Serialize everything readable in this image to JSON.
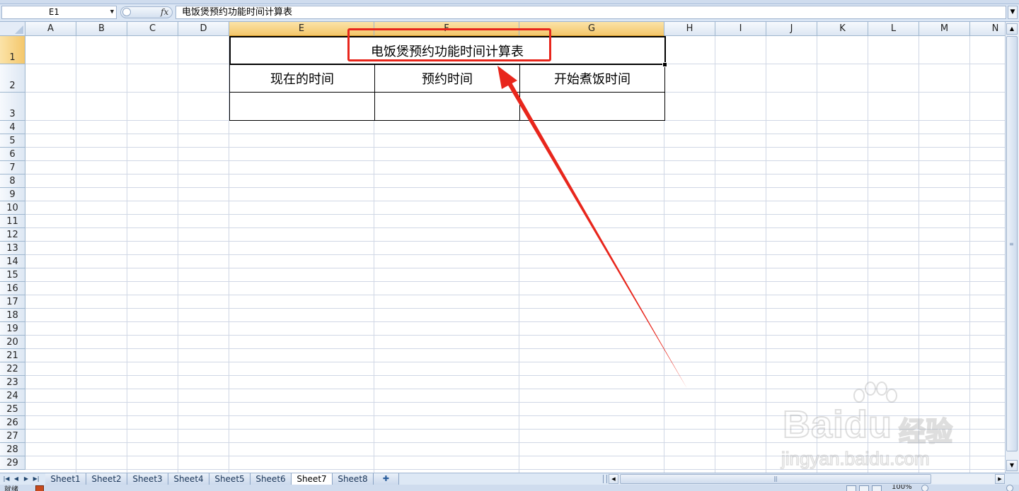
{
  "formula_bar": {
    "name_box": "E1",
    "fx_label": "fx",
    "content": "电饭煲预约功能时间计算表"
  },
  "columns": [
    "A",
    "B",
    "C",
    "D",
    "E",
    "F",
    "G",
    "H",
    "I",
    "J",
    "K",
    "L",
    "M",
    "N"
  ],
  "rows": [
    "1",
    "2",
    "3",
    "4",
    "5",
    "6",
    "7",
    "8",
    "9",
    "10",
    "11",
    "12",
    "13",
    "14",
    "15",
    "16",
    "17",
    "18",
    "19",
    "20",
    "21",
    "22",
    "23",
    "24",
    "25",
    "26",
    "27",
    "28",
    "29"
  ],
  "selected_cell": "E1",
  "table": {
    "title": "电饭煲预约功能时间计算表",
    "headers": [
      "现在的时间",
      "预约时间",
      "开始煮饭时间"
    ],
    "values": [
      "",
      "",
      ""
    ]
  },
  "sheet_tabs": [
    "Sheet1",
    "Sheet2",
    "Sheet3",
    "Sheet4",
    "Sheet5",
    "Sheet6",
    "Sheet7",
    "Sheet8"
  ],
  "active_sheet": "Sheet7",
  "status_bar": {
    "status": "就绪",
    "zoom": "100%"
  },
  "watermark": {
    "brand": "Baidu",
    "product": "经验",
    "url": "jingyan.baidu.com"
  },
  "annotation": {
    "highlight_color": "#e8261c"
  }
}
